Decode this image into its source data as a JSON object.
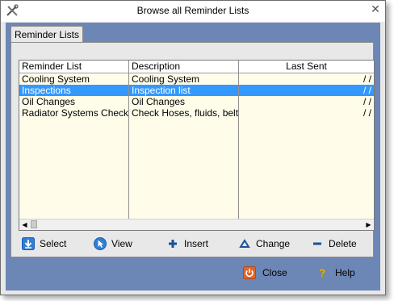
{
  "window": {
    "title": "Browse all Reminder Lists",
    "close_glyph": "✕"
  },
  "tab": {
    "label": "Reminder Lists"
  },
  "grid": {
    "columns": [
      "Reminder List",
      "Description",
      "Last Sent"
    ],
    "rows": [
      {
        "name": "Cooling System",
        "description": "Cooling System",
        "last_sent": "/ /",
        "selected": false
      },
      {
        "name": "Inspections",
        "description": "Inspection list",
        "last_sent": "/ /",
        "selected": true
      },
      {
        "name": "Oil Changes",
        "description": "Oil Changes",
        "last_sent": "/ /",
        "selected": false
      },
      {
        "name": "Radiator Systems Check",
        "description": "Check Hoses, fluids, belts",
        "last_sent": "/ /",
        "selected": false
      }
    ]
  },
  "actions": {
    "select": "Select",
    "view": "View",
    "insert": "Insert",
    "change": "Change",
    "delete": "Delete"
  },
  "footer": {
    "close": "Close",
    "help": "Help"
  },
  "icons": {
    "app": "tools-icon",
    "select": "select-down-arrow-icon",
    "view": "cursor-arrow-icon",
    "insert": "plus-icon",
    "change": "triangle-up-icon",
    "delete": "minus-icon",
    "close": "power-icon",
    "help": "question-icon"
  },
  "colors": {
    "client_bg": "#6c86b5",
    "grid_bg": "#fffdea",
    "selected_row": "#3399ff",
    "close_icon": "#e0672b"
  }
}
